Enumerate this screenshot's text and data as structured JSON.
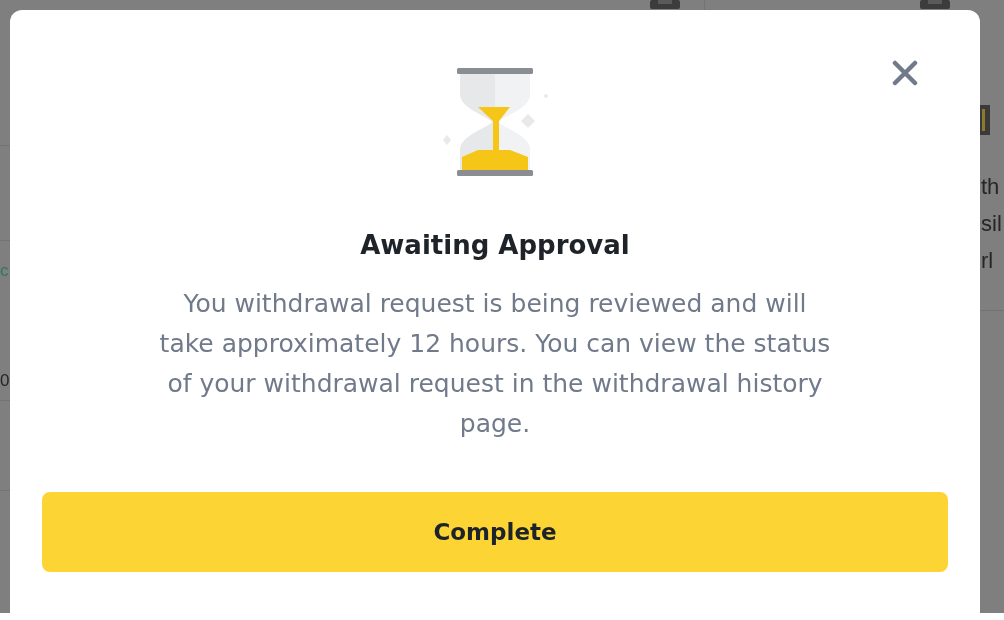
{
  "background": {
    "left": [
      {
        "text": "c",
        "kind": "link"
      },
      {
        "text": "0",
        "kind": "text"
      }
    ],
    "right": [
      {
        "text": "th"
      },
      {
        "text": "sil"
      },
      {
        "text": "rl"
      }
    ]
  },
  "dialog": {
    "title": "Awaiting Approval",
    "message": "You withdrawal request is being reviewed and will take approximately 12 hours. You can view the status of your withdrawal request in the withdrawal history page.",
    "button": "Complete"
  }
}
